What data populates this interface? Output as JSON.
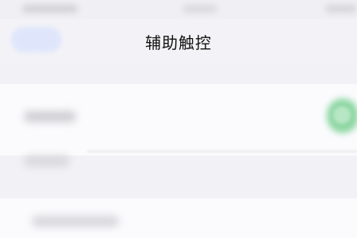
{
  "header": {
    "title": "辅助触控"
  },
  "settings": {
    "assistive_touch_toggle": {
      "on": true
    },
    "rows": [
      {
        "label": ""
      },
      {
        "label": ""
      },
      {
        "label": ""
      }
    ]
  },
  "colors": {
    "accent_blue": "#dfe6fb",
    "toggle_green": "#8fd7a4",
    "background": "#f2f2f6"
  }
}
